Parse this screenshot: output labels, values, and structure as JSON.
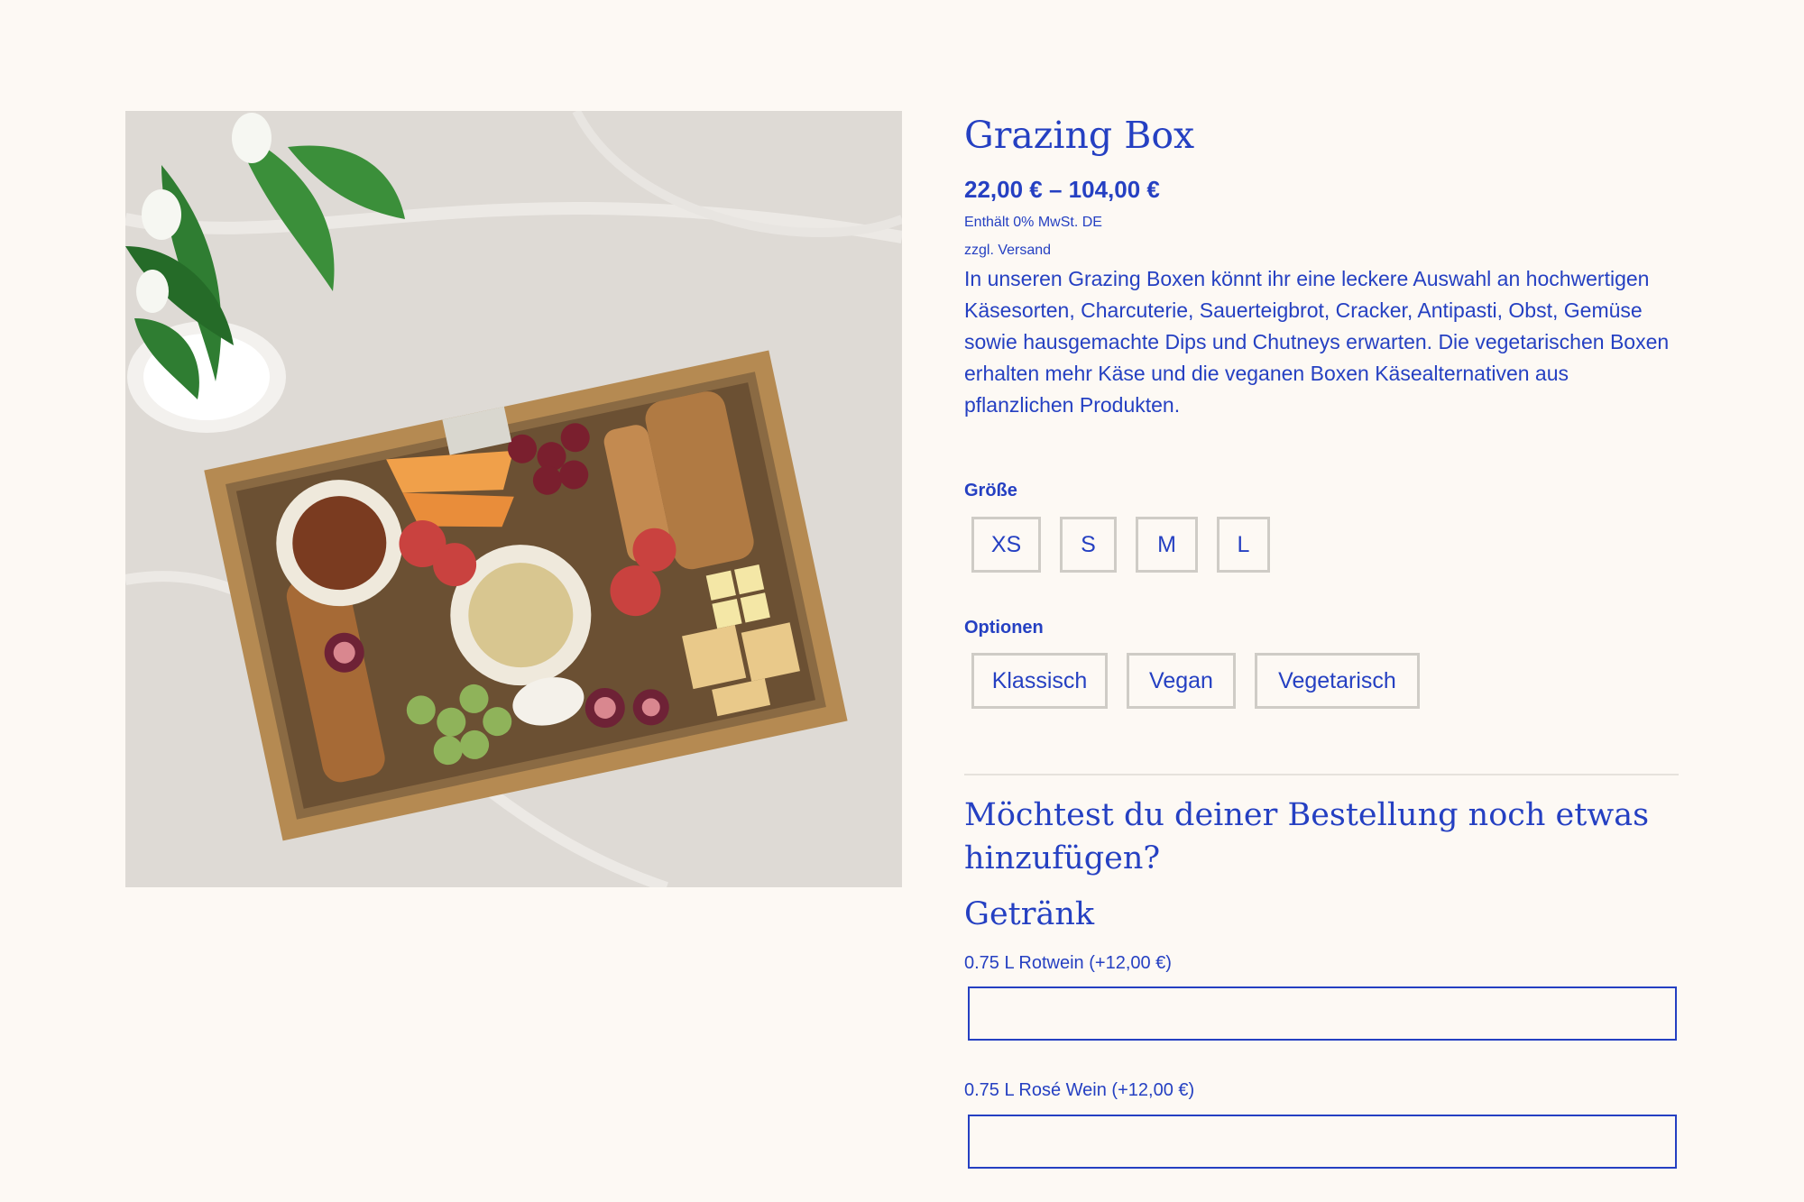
{
  "product": {
    "image_alt": "Grazing Box",
    "title": "Grazing Box",
    "price": "22,00 € – 104,00 €",
    "tax_note": "Enthält 0% MwSt. DE",
    "shipping_note": "zzgl. Versand",
    "description": "In unseren Grazing Boxen könnt ihr eine leckere Auswahl an hochwertigen Käsesorten, Charcuterie, Sauerteigbrot, Cracker, Antipasti, Obst, Gemüse sowie hausgemachte Dips und Chutneys erwarten. Die vegetarischen Boxen erhalten mehr Käse und die veganen Boxen Käsealternativen aus pflanzlichen Produkten."
  },
  "size": {
    "label": "Größe",
    "options": [
      "XS",
      "S",
      "M",
      "L"
    ]
  },
  "variant": {
    "label": "Optionen",
    "options": [
      "Klassisch",
      "Vegan",
      "Vegetarisch"
    ]
  },
  "addons": {
    "heading": "Möchtest du deiner Bestellung noch etwas hinzufügen?",
    "group_title": "Getränk",
    "items": [
      {
        "label": "0.75 L Rotwein (+12,00 €)",
        "value": ""
      },
      {
        "label": "0.75 L Rosé Wein (+12,00 €)",
        "value": ""
      }
    ]
  },
  "colors": {
    "accent": "#2540c2",
    "background": "#fdf9f4",
    "chip_border": "#cfccc6"
  }
}
